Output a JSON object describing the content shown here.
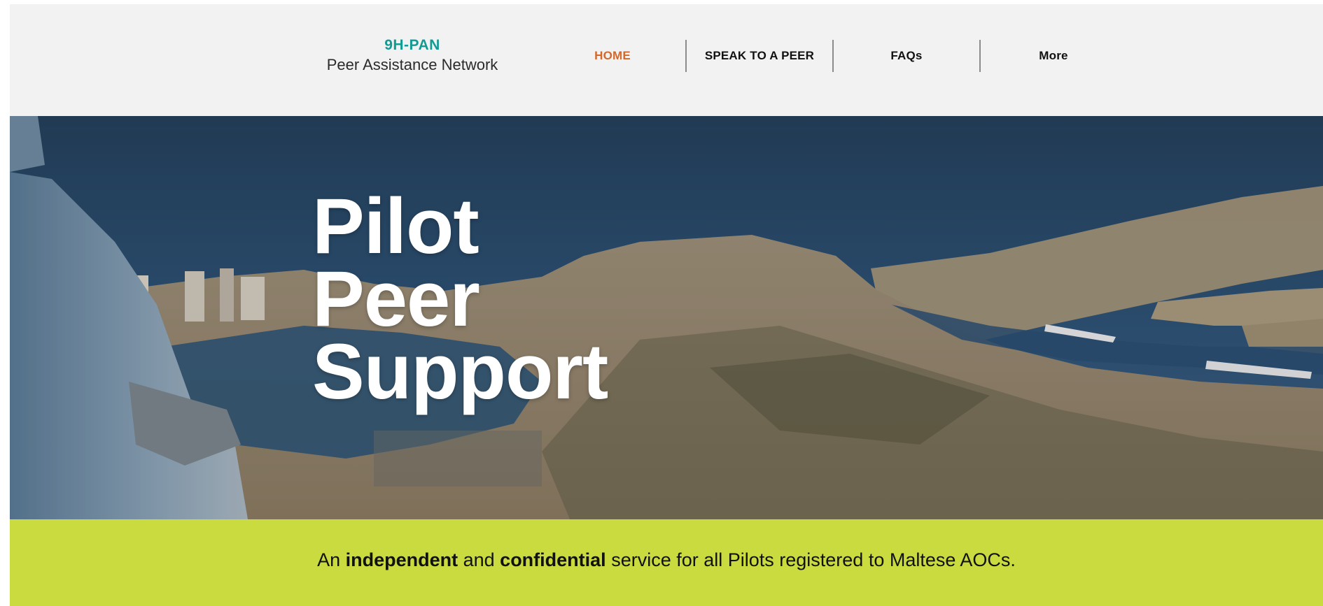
{
  "brand": {
    "code": "9H-PAN",
    "name": "Peer Assistance Network"
  },
  "nav": {
    "items": [
      {
        "label": "HOME",
        "active": true
      },
      {
        "label": "SPEAK TO A PEER",
        "active": false
      },
      {
        "label": "FAQs",
        "active": false
      },
      {
        "label": "More",
        "active": false
      }
    ]
  },
  "hero": {
    "title_lines": [
      "Pilot",
      "Peer",
      "Support"
    ],
    "image": "aerial-photo-malta-harbour-from-aircraft"
  },
  "banner": {
    "part1": "An ",
    "bold1": "independent",
    "part2": " and ",
    "bold2": "confidential",
    "part3": " service for all Pilots registered to Maltese AOCs."
  },
  "colors": {
    "header_bg": "#f2f2f2",
    "brand_accent": "#139a93",
    "nav_active": "#d4682a",
    "banner_bg": "#cadb3f",
    "sea": "#2d4d6c"
  }
}
